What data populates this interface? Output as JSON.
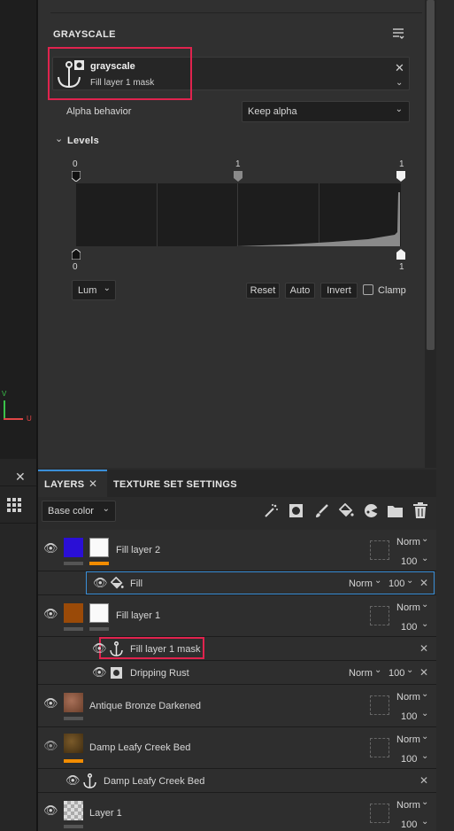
{
  "properties": {
    "section_title": "GRAYSCALE",
    "resource": {
      "name": "grayscale",
      "subtitle": "Fill layer 1 mask"
    },
    "alpha_label": "Alpha behavior",
    "alpha_value": "Keep alpha",
    "levels_title": "Levels",
    "levels_top_ticks": [
      "0",
      "1",
      "1"
    ],
    "levels_bottom_ticks": [
      "0",
      "1"
    ],
    "channel": "Lum",
    "buttons": {
      "reset": "Reset",
      "auto": "Auto",
      "invert": "Invert"
    },
    "clamp_label": "Clamp"
  },
  "viewport": {
    "axis_v": "V",
    "axis_u": "U"
  },
  "layers": {
    "tabs": [
      "LAYERS",
      "TEXTURE SET SETTINGS"
    ],
    "channel_select": "Base color",
    "items": [
      {
        "name": "Fill layer 2",
        "blend": "Norm",
        "opacity": "100",
        "color": "#2a0fd6"
      },
      {
        "name": "Fill",
        "blend": "Norm",
        "opacity": "100"
      },
      {
        "name": "Fill layer 1",
        "blend": "Norm",
        "opacity": "100",
        "color": "#9a4a08"
      },
      {
        "name": "Fill layer 1 mask"
      },
      {
        "name": "Dripping Rust",
        "blend": "Norm",
        "opacity": "100"
      },
      {
        "name": "Antique Bronze Darkened",
        "blend": "Norm",
        "opacity": "100"
      },
      {
        "name": "Damp Leafy Creek Bed",
        "blend": "Norm",
        "opacity": "100"
      },
      {
        "name": "Damp Leafy Creek Bed"
      },
      {
        "name": "Layer 1",
        "blend": "Norm",
        "opacity": "100"
      }
    ]
  },
  "colors": {
    "accent": "#f28c00",
    "highlight": "#e0234e",
    "selection": "#3a8fd8"
  }
}
